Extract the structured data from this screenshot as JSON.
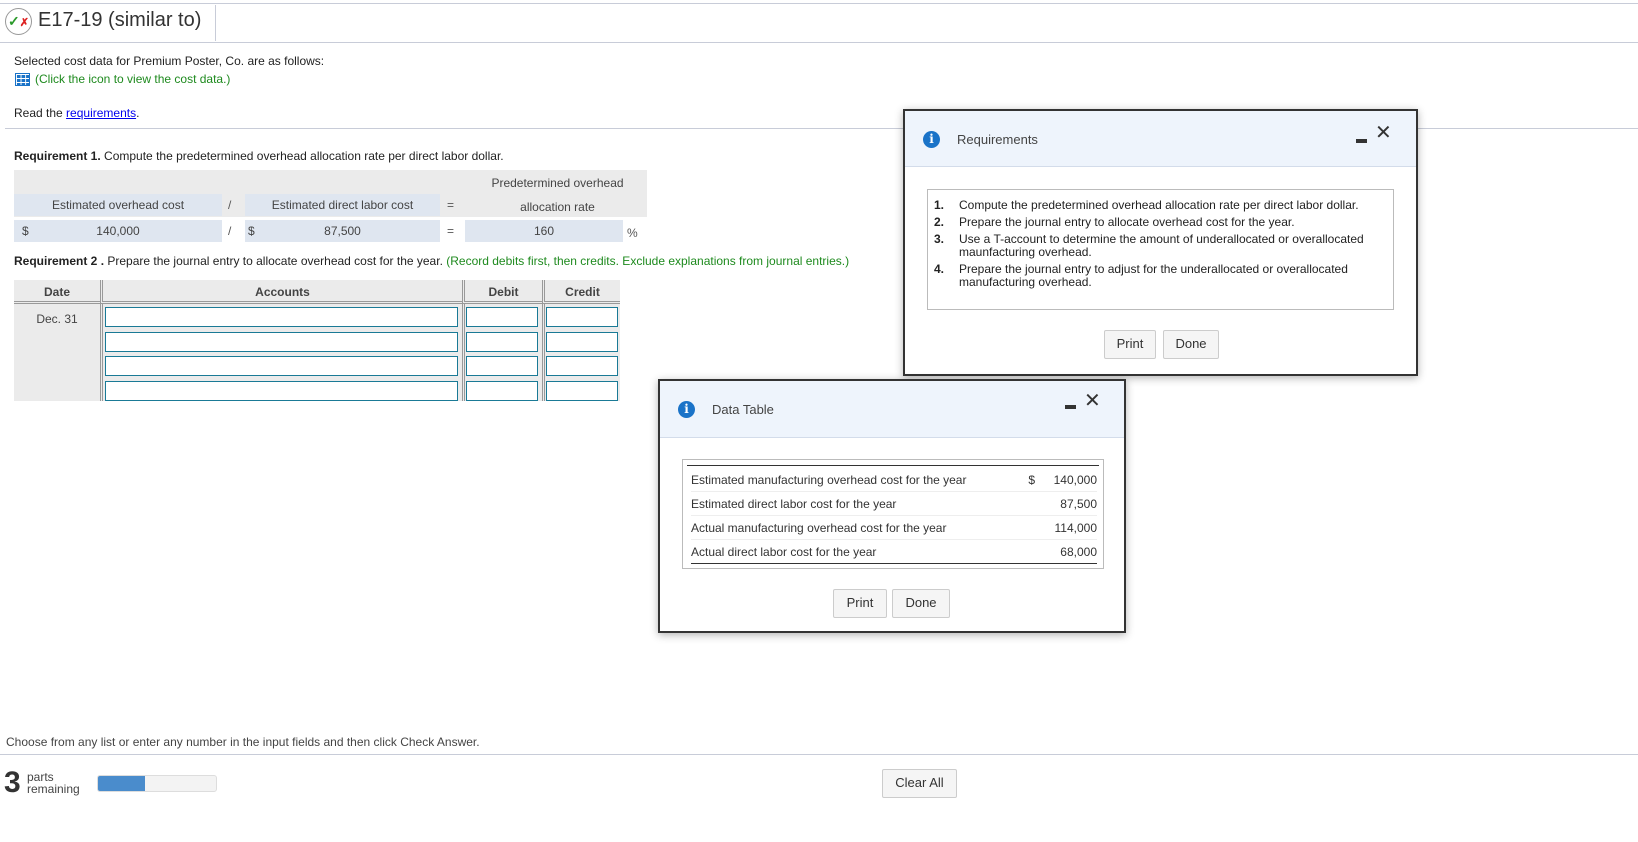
{
  "header": {
    "title": "E17-19 (similar to)",
    "status_icon": "partial-correct-icon"
  },
  "intro": {
    "text": "Selected cost data for Premium Poster, Co. are as follows:",
    "data_link": "(Click the icon to view the cost data.)",
    "read_prefix": "Read the ",
    "read_link": "requirements",
    "read_suffix": "."
  },
  "req1": {
    "bold": "Requirement 1.",
    "text": " Compute the predetermined overhead allocation rate per direct labor dollar.",
    "col1": "Estimated overhead cost",
    "op1": "/",
    "col2": "Estimated direct labor cost",
    "op2": "=",
    "col3_line1": "Predetermined overhead",
    "col3_line2": "allocation rate",
    "currency": "$",
    "val1": "140,000",
    "val2": "87,500",
    "val3": "160",
    "unit": "%"
  },
  "req2": {
    "bold": "Requirement 2 .",
    "text": " Prepare the journal entry to allocate overhead cost for the year.",
    "note": " (Record debits first, then credits. Exclude explanations from journal entries.)",
    "headers": [
      "Date",
      "Accounts",
      "Debit",
      "Credit"
    ],
    "date": "Dec. 31"
  },
  "footer": {
    "instruction": "Choose from any list or enter any number in the input fields and then click Check Answer.",
    "parts_count": "3",
    "parts_line1": "parts",
    "parts_line2": "remaining",
    "progress_percent": 40,
    "clear_all": "Clear All"
  },
  "requirements_dialog": {
    "title": "Requirements",
    "items": [
      {
        "n": "1.",
        "text": "Compute the predetermined overhead allocation rate per direct labor dollar."
      },
      {
        "n": "2.",
        "text": "Prepare the journal entry to allocate overhead cost for the year."
      },
      {
        "n": "3.",
        "text": "Use a T-account to determine the amount of underallocated or overallocated maunfacturing overhead."
      },
      {
        "n": "4.",
        "text": "Prepare the journal entry to adjust for the underallocated or overallocated manufacturing overhead."
      }
    ],
    "print": "Print",
    "done": "Done"
  },
  "data_dialog": {
    "title": "Data Table",
    "rows": [
      {
        "label": "Estimated manufacturing overhead cost for the year",
        "currency": "$",
        "value": "140,000"
      },
      {
        "label": "Estimated direct labor cost for the year",
        "currency": "",
        "value": "87,500"
      },
      {
        "label": "Actual manufacturing overhead cost for the year",
        "currency": "",
        "value": "114,000"
      },
      {
        "label": "Actual direct labor cost for the year",
        "currency": "",
        "value": "68,000"
      }
    ],
    "print": "Print",
    "done": "Done"
  },
  "colors": {
    "accent": "#1a73c8",
    "green_note": "#1e8a1e",
    "input_border": "#1a7a96",
    "progress": "#4a8ccc"
  }
}
